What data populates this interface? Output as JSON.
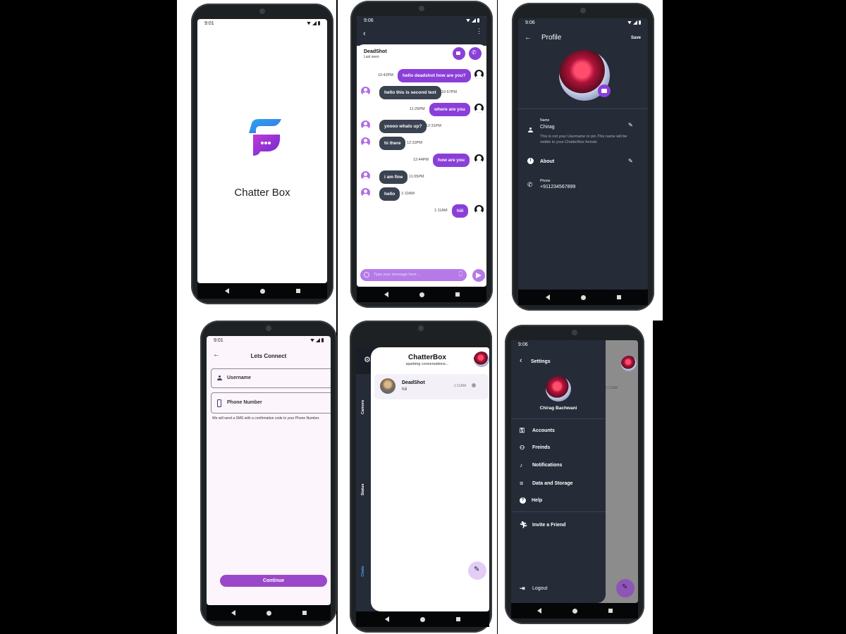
{
  "colors": {
    "accent": "#8b3fd9",
    "dark_bg": "#252b37",
    "outgoing": "#8b3fd9",
    "incoming": "#3b4250"
  },
  "splash": {
    "time": "9:01",
    "app_name": "Chatter Box"
  },
  "chat": {
    "time": "9:06",
    "contact_name": "DeadShot",
    "last_seen": "Last seen",
    "messages": [
      {
        "dir": "out",
        "text": "hello deadshot how are you?",
        "time": "10:42PM"
      },
      {
        "dir": "in",
        "text": "hello this is second text",
        "time": "10:57PM"
      },
      {
        "dir": "out",
        "text": "where are you",
        "time": "11:29PM"
      },
      {
        "dir": "in",
        "text": "yoooo whats up?",
        "time": "12:31PM"
      },
      {
        "dir": "in",
        "text": "hi there",
        "time": "12:32PM"
      },
      {
        "dir": "out",
        "text": "how are you",
        "time": "12:44PM"
      },
      {
        "dir": "in",
        "text": "i am fine",
        "time": "11:05PM"
      },
      {
        "dir": "in",
        "text": "hello",
        "time": "1:10AM"
      },
      {
        "dir": "out",
        "text": "hiii",
        "time": "1:11AM"
      }
    ],
    "input_placeholder": "Type your message here ..."
  },
  "profile": {
    "time": "9:06",
    "title": "Profile",
    "save_label": "Save",
    "name_label": "Name",
    "name_value": "Chirag",
    "name_hint": "This is not your Username or pin.This name will be visible to your ChatterBox freinds",
    "about_label": "About",
    "phone_label": "Phone",
    "phone_value": "+911234567899"
  },
  "login": {
    "time": "9:01",
    "title": "Lets Connect",
    "username_placeholder": "Username",
    "phone_placeholder": "Phone Number",
    "sms_note": "We will send a SMS with a confirmation code to your Phone Number.",
    "continue_label": "Continue"
  },
  "home": {
    "app_title": "ChatterBox",
    "subtitle": "sparking conversations...",
    "side_tabs": [
      "Camera",
      "Status",
      "Chats"
    ],
    "chats": [
      {
        "name": "DeadShot",
        "preview": "hiii",
        "time": "1:11AM"
      }
    ]
  },
  "settings": {
    "time": "9:06",
    "title": "Settings",
    "user_name": "Chirag Bachwani",
    "items": [
      "Accounts",
      "Freinds",
      "Notifications",
      "Data and Storage",
      "Help"
    ],
    "invite_label": "Invite a Friend",
    "logout_label": "Logout",
    "behind_time": "1:11AM"
  }
}
